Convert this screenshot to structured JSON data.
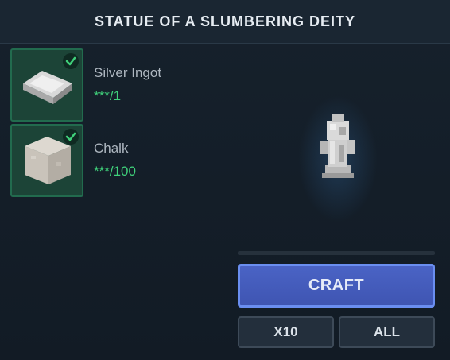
{
  "header": {
    "title": "STATUE OF A SLUMBERING DEITY"
  },
  "ingredients": [
    {
      "name": "Silver Ingot",
      "count": "***/1",
      "icon": "silver-ingot-icon",
      "satisfied": true
    },
    {
      "name": "Chalk",
      "count": "***/100",
      "icon": "chalk-block-icon",
      "satisfied": true
    }
  ],
  "preview": {
    "icon": "deity-statue-icon"
  },
  "progress": {
    "value": 0
  },
  "actions": {
    "craft_label": "CRAFT",
    "x10_label": "X10",
    "all_label": "ALL"
  },
  "colors": {
    "accent": "#4a63c5",
    "accent_border": "#6a8ef0",
    "ingredient_ok": "#3fd07a",
    "ingredient_bg": "#1c4437"
  }
}
